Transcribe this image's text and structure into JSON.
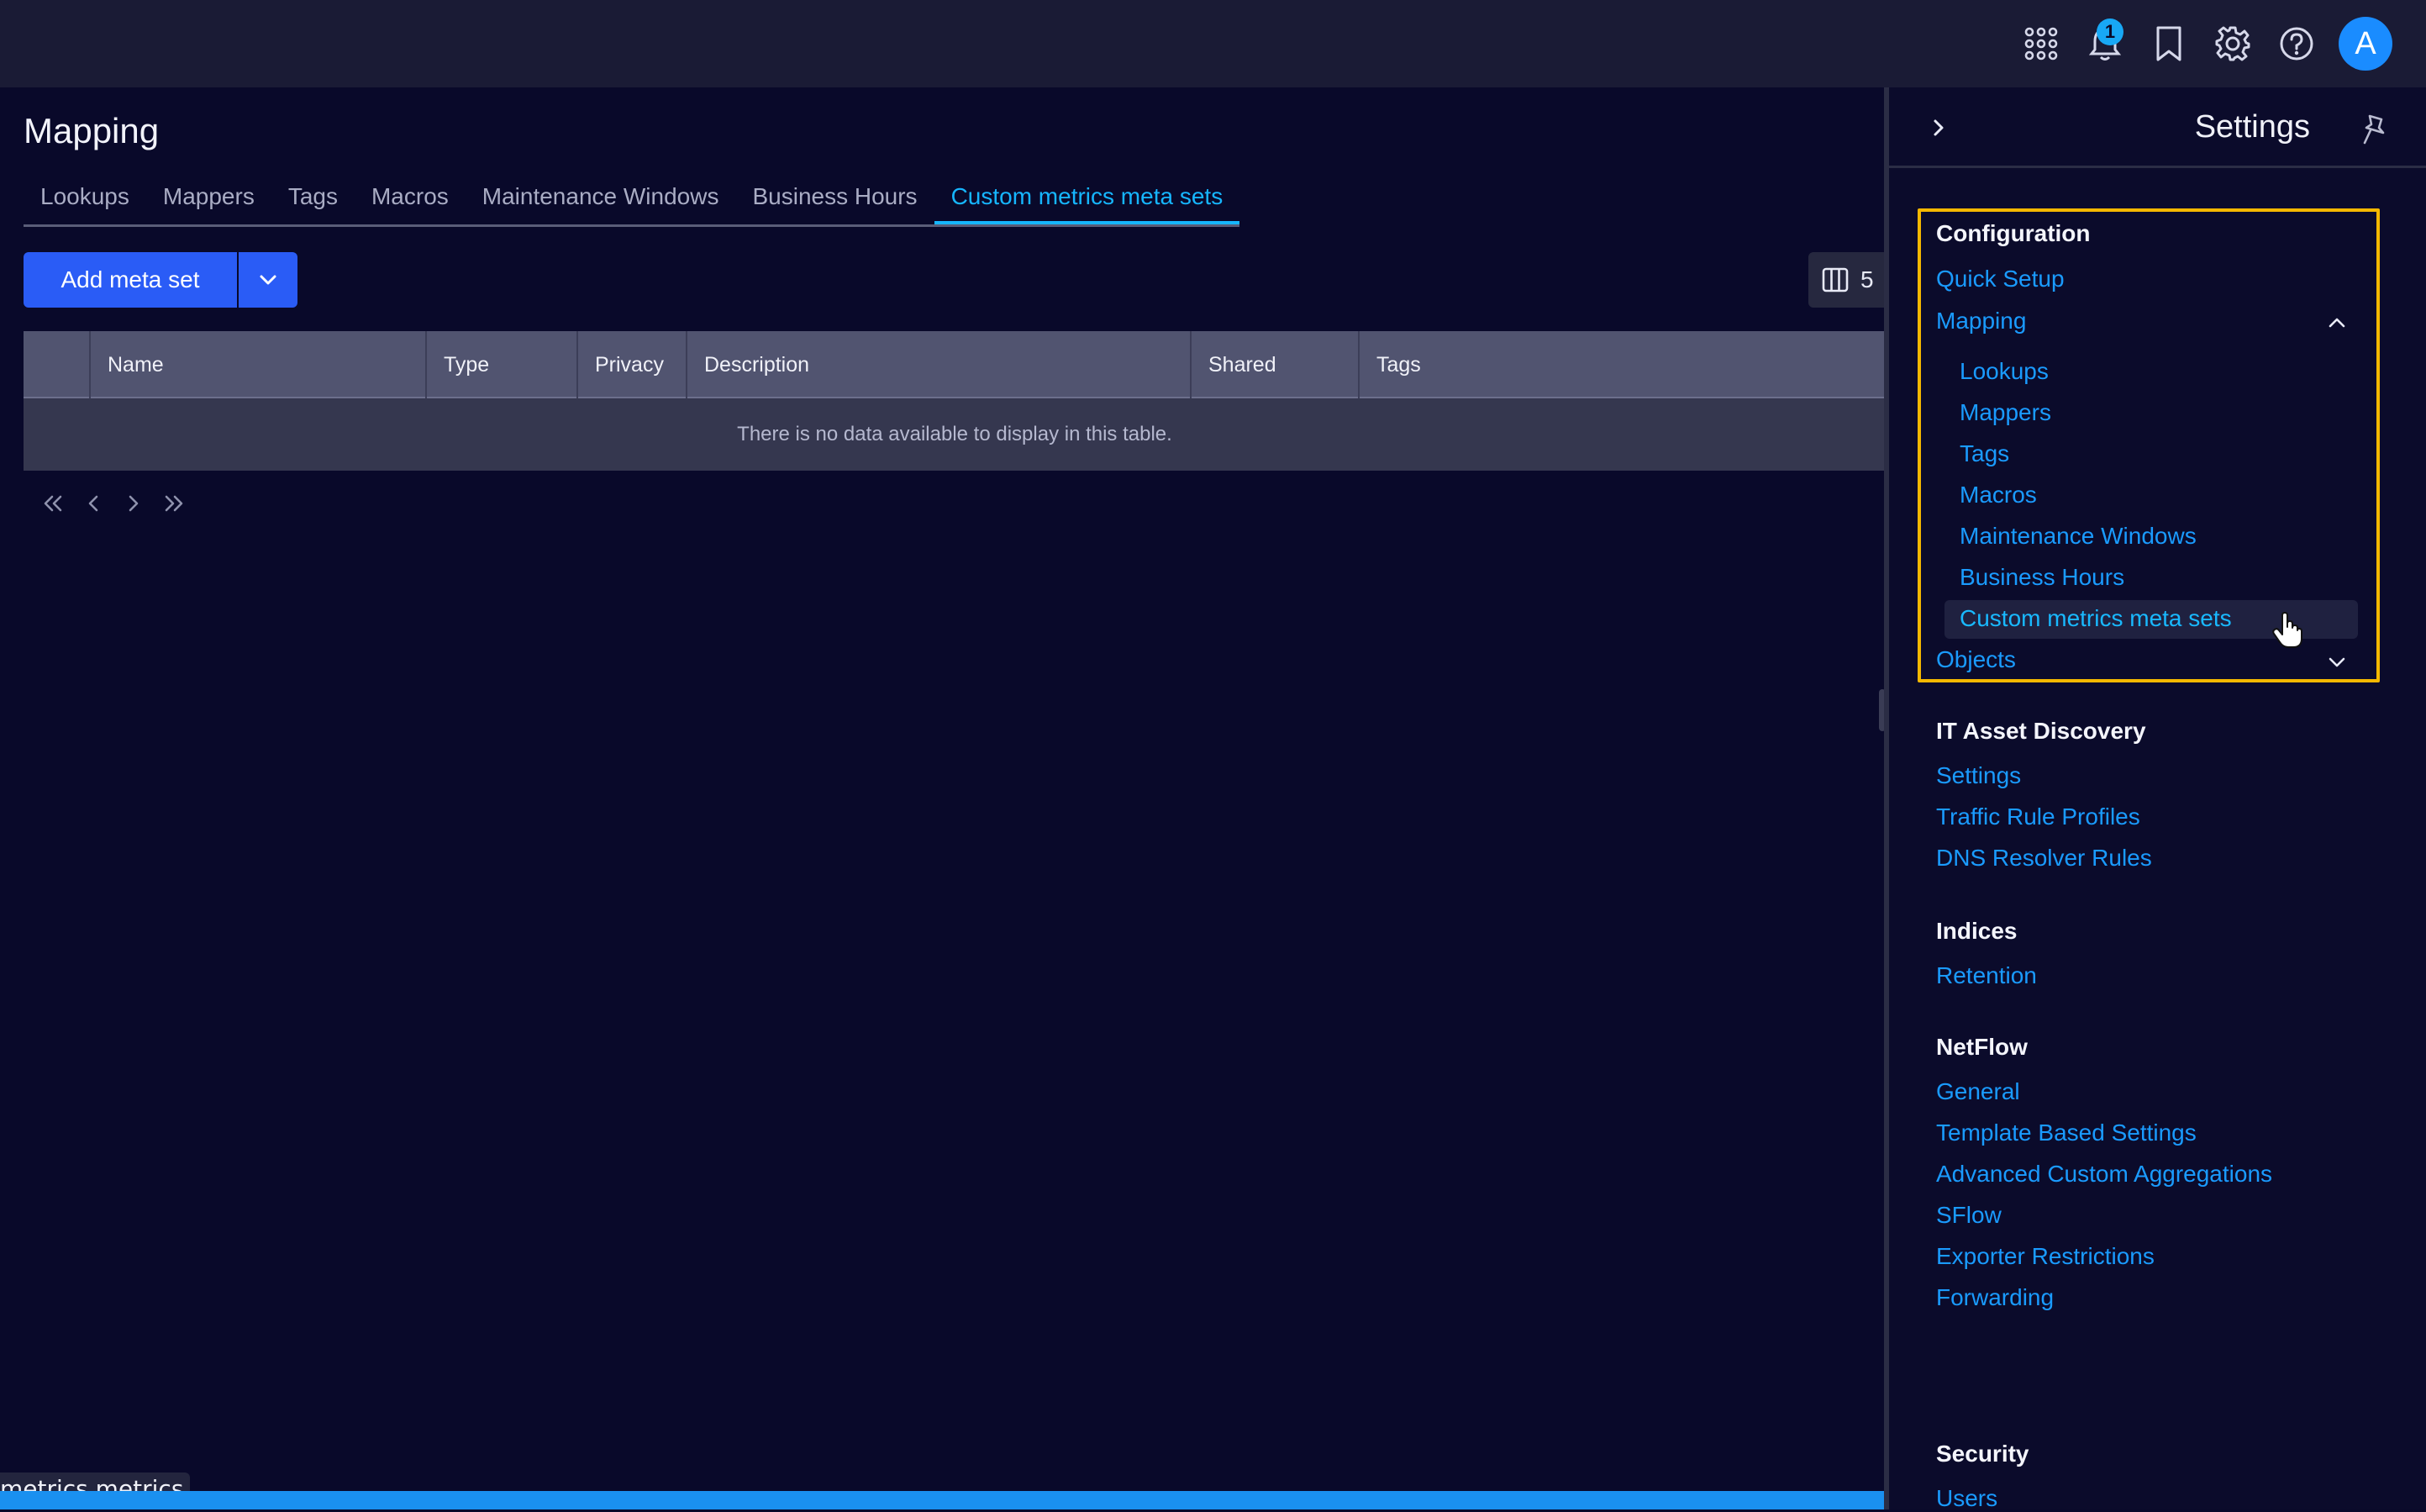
{
  "topbar": {
    "notification_count": "1",
    "avatar_letter": "A"
  },
  "page": {
    "title": "Mapping",
    "tabs": [
      {
        "label": "Lookups",
        "active": false
      },
      {
        "label": "Mappers",
        "active": false
      },
      {
        "label": "Tags",
        "active": false
      },
      {
        "label": "Macros",
        "active": false
      },
      {
        "label": "Maintenance Windows",
        "active": false
      },
      {
        "label": "Business Hours",
        "active": false
      },
      {
        "label": "Custom metrics meta sets",
        "active": true
      }
    ],
    "add_button_label": "Add meta set",
    "column_count": "5"
  },
  "table": {
    "columns": [
      "Name",
      "Type",
      "Privacy",
      "Description",
      "Shared",
      "Tags"
    ],
    "empty_message": "There is no data available to display in this table."
  },
  "status_tooltip": "metrics.metrics",
  "settings_panel": {
    "title": "Settings",
    "sections": [
      {
        "heading": "Configuration",
        "items": [
          "Quick Setup",
          "Mapping"
        ],
        "mapping_children": [
          "Lookups",
          "Mappers",
          "Tags",
          "Macros",
          "Maintenance Windows",
          "Business Hours",
          "Custom metrics meta sets"
        ],
        "trailing": "Objects"
      },
      {
        "heading": "IT Asset Discovery",
        "items": [
          "Settings",
          "Traffic Rule Profiles",
          "DNS Resolver Rules"
        ]
      },
      {
        "heading": "Indices",
        "items": [
          "Retention"
        ]
      },
      {
        "heading": "NetFlow",
        "items": [
          "General",
          "Template Based Settings",
          "Advanced Custom Aggregations",
          "SFlow",
          "Exporter Restrictions",
          "Forwarding"
        ]
      },
      {
        "heading": "Security",
        "items": [
          "Users"
        ]
      }
    ]
  },
  "colors": {
    "background": "#09092a",
    "topbar": "#1a1b35",
    "accent": "#16b6ff",
    "link": "#1a9bff",
    "primary_button": "#2a5cf6",
    "highlight_border": "#f5b800"
  },
  "icons": [
    "apps-grid-icon",
    "bell-icon",
    "bookmark-icon",
    "gear-icon",
    "help-icon",
    "chevron-down-icon",
    "columns-icon",
    "first-page-icon",
    "prev-page-icon",
    "next-page-icon",
    "last-page-icon",
    "chevron-right-icon",
    "pin-icon",
    "chevron-up-icon",
    "hand-cursor-icon"
  ]
}
